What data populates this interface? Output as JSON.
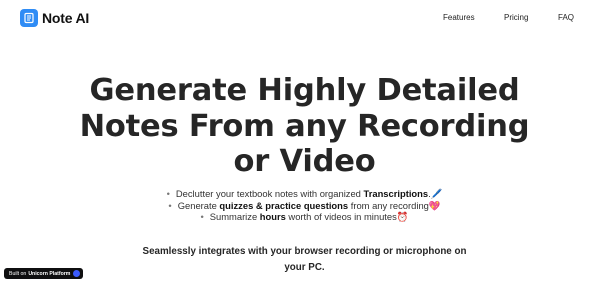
{
  "nav": {
    "brand": "Note AI",
    "brand_color": "#2f8cf5",
    "brand_icon": "note-book-icon",
    "links": [
      "Features",
      "Pricing",
      "FAQ"
    ]
  },
  "hero": {
    "title_lines": [
      "Generate Highly Detailed",
      "Notes From any Recording",
      "or Video"
    ]
  },
  "features": [
    {
      "before": "Declutter your textbook notes with organized ",
      "bold": "Transcriptions",
      "after": ".",
      "emoji": "🖊️"
    },
    {
      "before": "Generate ",
      "bold": "quizzes & practice questions",
      "after": " from any recording",
      "emoji": "💖"
    },
    {
      "before": "Summarize ",
      "bold": "hours",
      "after": " worth of videos in minutes",
      "emoji": "⏰"
    }
  ],
  "subheading_lines": [
    "Seamlessly integrates with your browser recording or microphone on",
    "your PC."
  ],
  "badge": {
    "prefix": "Built on",
    "platform": "Unicorn Platform",
    "icon": "unicorn-platform-icon",
    "icon_color": "#3b5bfd"
  }
}
